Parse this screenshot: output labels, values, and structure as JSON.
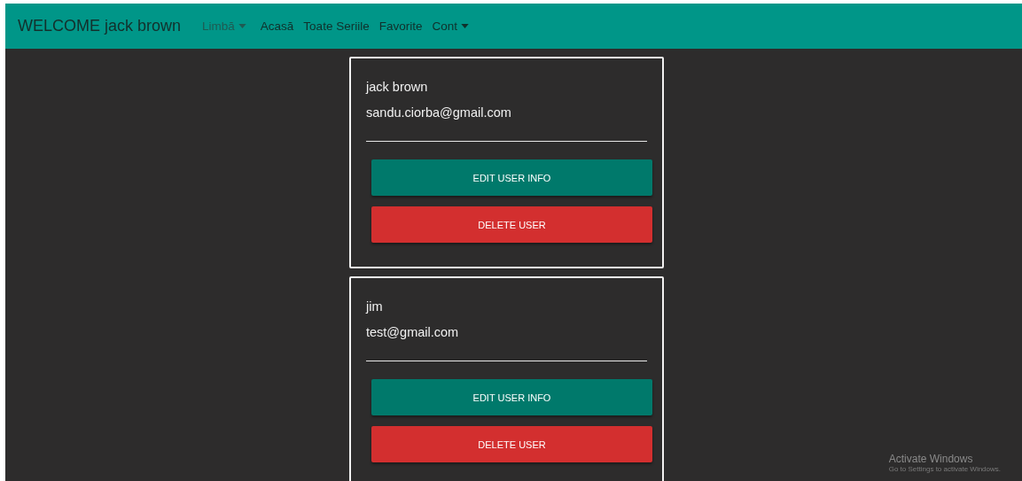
{
  "navbar": {
    "brand": "WELCOME jack brown",
    "items": [
      {
        "label": "Limbă",
        "kind": "dropdown",
        "muted": true
      },
      {
        "label": "Acasă",
        "kind": "link",
        "muted": false
      },
      {
        "label": "Toate Seriile",
        "kind": "link",
        "muted": false
      },
      {
        "label": "Favorite",
        "kind": "link",
        "muted": false
      },
      {
        "label": "Cont",
        "kind": "dropdown",
        "muted": false
      }
    ]
  },
  "users": [
    {
      "name": "jack brown",
      "email": "sandu.ciorba@gmail.com",
      "buttons": [
        {
          "label": "EDIT USER INFO",
          "kind": "edit"
        },
        {
          "label": "DELETE USER",
          "kind": "delete"
        }
      ]
    },
    {
      "name": "jim",
      "email": "test@gmail.com",
      "buttons": [
        {
          "label": "EDIT USER INFO",
          "kind": "edit"
        },
        {
          "label": "DELETE USER",
          "kind": "delete"
        }
      ]
    }
  ],
  "os_notice": {
    "title": "Activate Windows",
    "text": "Go to Settings to activate Windows."
  }
}
